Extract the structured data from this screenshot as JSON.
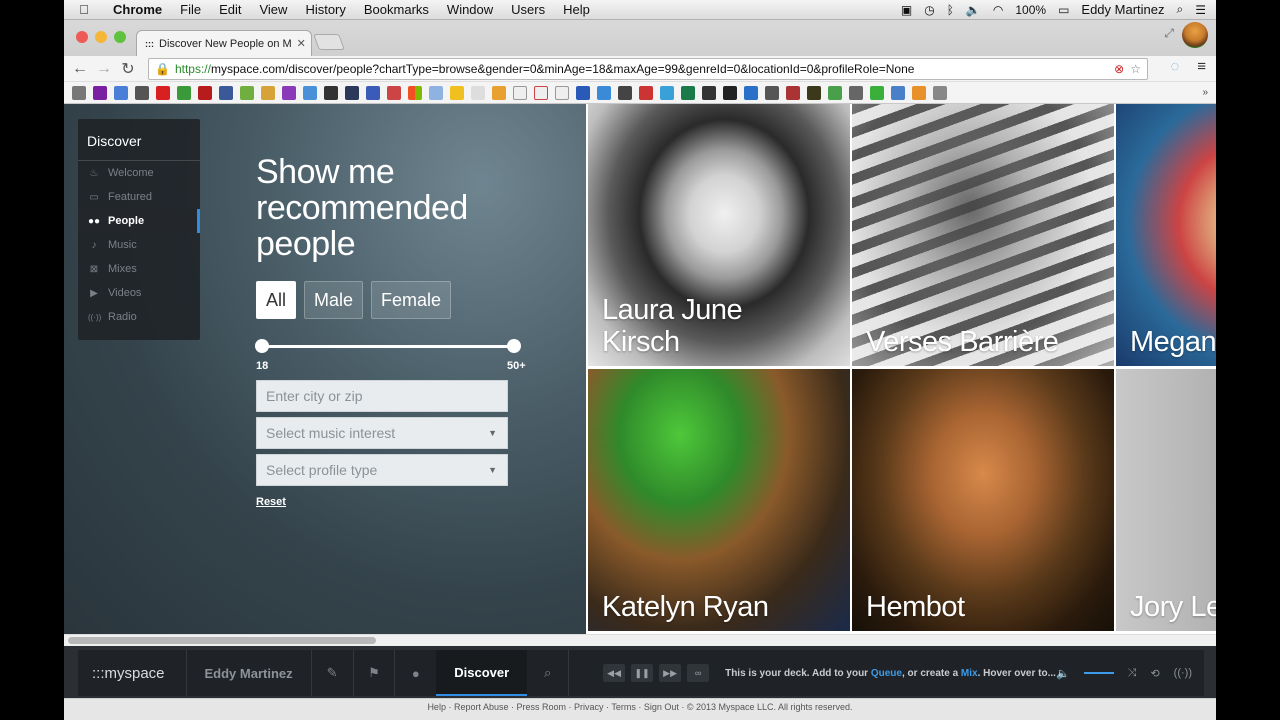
{
  "menubar": {
    "apple": "",
    "items": [
      "Chrome",
      "File",
      "Edit",
      "View",
      "History",
      "Bookmarks",
      "Window",
      "Users",
      "Help"
    ],
    "battery": "100%",
    "user": "Eddy Martinez"
  },
  "browser": {
    "tab_title": "Discover New People on M",
    "url_https": "https://",
    "url_rest": "myspace.com/discover/people?chartType=browse&gender=0&minAge=18&maxAge=99&genreId=0&locationId=0&profileRole=None"
  },
  "colors": {
    "accent": "#2f8de4",
    "traffic_red": "#ee5b54",
    "traffic_yellow": "#f5b73a",
    "traffic_green": "#5fc23f"
  },
  "sidenav": {
    "title": "Discover",
    "items": [
      {
        "label": "Welcome",
        "icon": "flame-icon",
        "glyph": "♨"
      },
      {
        "label": "Featured",
        "icon": "featured-icon",
        "glyph": "▭"
      },
      {
        "label": "People",
        "icon": "people-icon",
        "glyph": "👥"
      },
      {
        "label": "Music",
        "icon": "music-note-icon",
        "glyph": "♪"
      },
      {
        "label": "Mixes",
        "icon": "mix-icon",
        "glyph": "⊠"
      },
      {
        "label": "Videos",
        "icon": "video-icon",
        "glyph": "▶"
      },
      {
        "label": "Radio",
        "icon": "radio-icon",
        "glyph": "((·))"
      }
    ],
    "active": "People"
  },
  "filters": {
    "headline": "Show me recommended people",
    "gender_options": [
      "All",
      "Male",
      "Female"
    ],
    "selected_gender": "All",
    "age_min": "18",
    "age_max": "50+",
    "location_placeholder": "Enter city or zip",
    "music_placeholder": "Select music interest",
    "profile_placeholder": "Select profile type",
    "reset_label": "Reset"
  },
  "people": [
    "Laura June Kirsch",
    "Verses Barrière",
    "Megan",
    "Katelyn Ryan",
    "Hembot",
    "Jory Le"
  ],
  "deck": {
    "logo": ":::myspace",
    "user": "Eddy Martinez",
    "discover": "Discover",
    "message_pre": "This is your deck. Add to your ",
    "queue": "Queue",
    "message_mid": ", or create a ",
    "mix": "Mix",
    "message_post": ". Hover over to..."
  },
  "footer": "Help · Report Abuse · Press Room · Privacy · Terms · Sign Out · © 2013 Myspace LLC. All rights reserved."
}
